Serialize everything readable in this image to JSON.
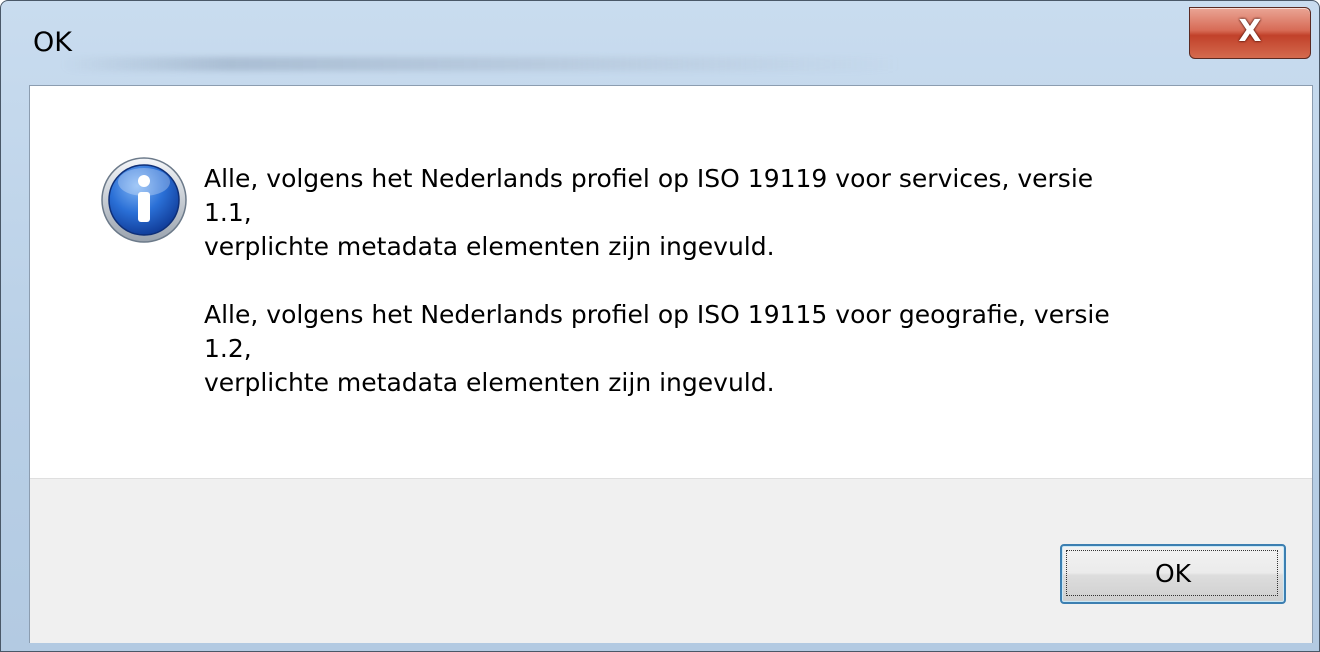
{
  "window": {
    "title": "OK",
    "close_glyph": "X",
    "colors": {
      "titlebar": "#b8cfe6",
      "close_button": "#c1412a",
      "client_background": "#ffffff",
      "footer_background": "#f0f0f0"
    }
  },
  "message": {
    "icon": "information-icon",
    "paragraphs": [
      "Alle, volgens het Nederlands profiel op ISO 19119 voor services, versie\n1.1,\nverplichte metadata elementen zijn ingevuld.",
      "Alle, volgens het Nederlands profiel op ISO 19115 voor geografie, versie\n1.2,\nverplichte metadata elementen zijn ingevuld."
    ]
  },
  "buttons": {
    "ok_label": "OK"
  }
}
